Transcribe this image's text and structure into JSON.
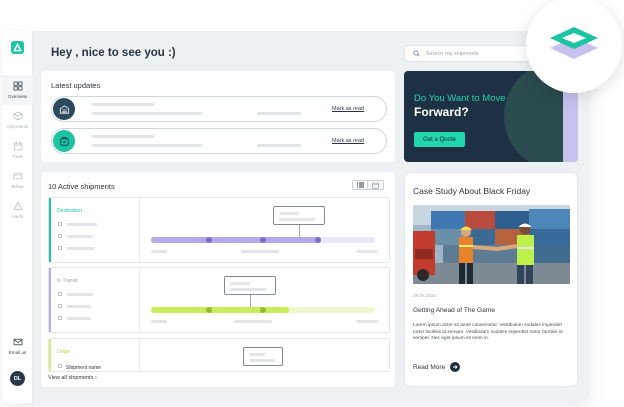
{
  "header": {
    "greeting": "Hey , nice to see you :)"
  },
  "search": {
    "placeholder": "Search my shipments"
  },
  "sidebar": {
    "items": [
      {
        "label": "Overview",
        "icon": "grid-icon"
      },
      {
        "label": "Shipments",
        "icon": "box-icon"
      },
      {
        "label": "Tools",
        "icon": "calendar-icon"
      },
      {
        "label": "Billing",
        "icon": "card-icon"
      },
      {
        "label": "Alerts",
        "icon": "warning-icon"
      }
    ],
    "email_label": "Email us",
    "avatar_initials": "DL"
  },
  "updates": {
    "title": "Latest updates",
    "items": [
      {
        "action": "Mark as read",
        "icon": "warehouse-icon",
        "icon_bg": "#2b4a5c"
      },
      {
        "action": "Mark as read",
        "icon": "package-icon",
        "icon_bg": "#1dc4a3"
      }
    ]
  },
  "shipments": {
    "title": "10 Active shipments",
    "view_all": "View all shipments",
    "items": [
      {
        "status": "Destination",
        "status_color": "#1dc4a3",
        "progress_color": "#b9a9e6"
      },
      {
        "status": "In Transit",
        "status_color": "#b9a9e6",
        "progress_color": "#c8ec5a"
      },
      {
        "status": "Origin",
        "status_color": "#d7ef7a",
        "name": "Shipment name"
      }
    ]
  },
  "promo": {
    "line1": "Do You Want to Move",
    "line2": "Forward?",
    "button": "Get a Quote"
  },
  "case_study": {
    "title": "Case Study About Black Friday",
    "date": "29.05.2022",
    "subtitle": "Getting Ahead of The Game",
    "body": "Lorem ipsum dolor sit amet consectetur. Vestibulum sodales imperdiet tortor facilisis id semper. Vestibulum sodales imperdiet tortor facilisis id semper. Nec eget ipsum sit enim in.",
    "read_more": "Read More"
  },
  "colors": {
    "accent": "#1dc4a3",
    "navy": "#1e3043",
    "lavender": "#c6c1ee",
    "lime": "#c8ec5a"
  }
}
